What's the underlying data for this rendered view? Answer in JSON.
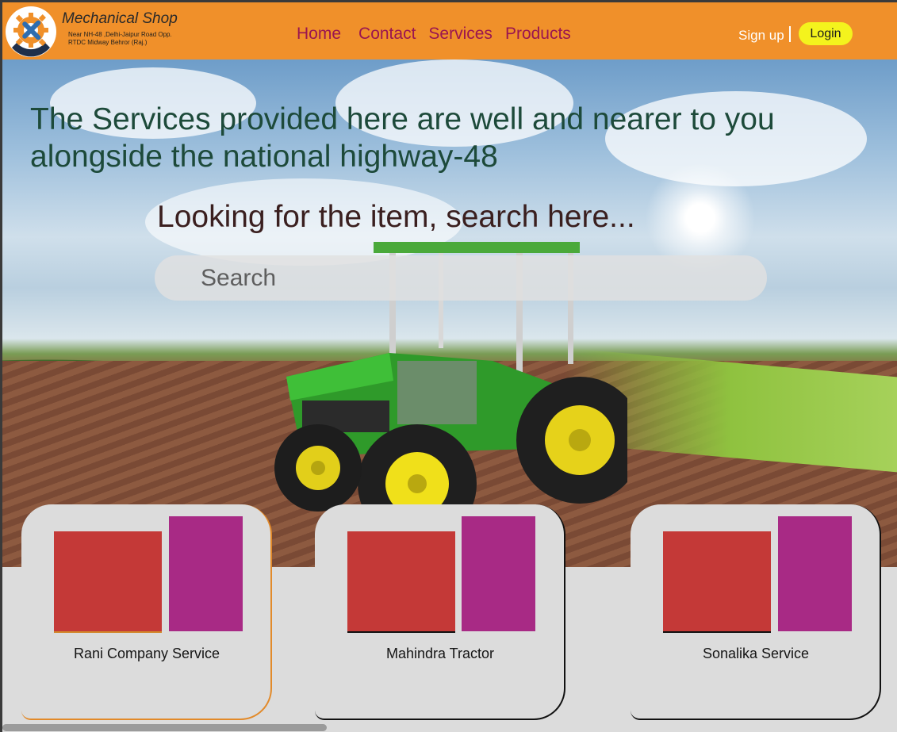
{
  "header": {
    "brand_name": "Mechanical Shop",
    "address_line1": "Near NH-48 ,Delhi-Jaipur Road Opp.",
    "address_line2": "RTDC Midway Behror (Raj.)",
    "nav": [
      "Home",
      "Contact",
      "Services",
      "Products"
    ],
    "signup_label": "Sign up",
    "login_label": "Login"
  },
  "hero": {
    "headline": "The Services provided here are well and nearer to you alongside the national highway-48",
    "search_title": "Looking for the item, search here...",
    "search_placeholder": "Search"
  },
  "cards": [
    {
      "label": "Rani Company Service"
    },
    {
      "label": "Mahindra Tractor"
    },
    {
      "label": "Sonalika Service"
    }
  ],
  "colors": {
    "header_bg": "#f0902a",
    "nav_text": "#9a1550",
    "login_bg": "#f4f31d",
    "card_red": "#c43937",
    "card_magenta": "#a82a85"
  }
}
